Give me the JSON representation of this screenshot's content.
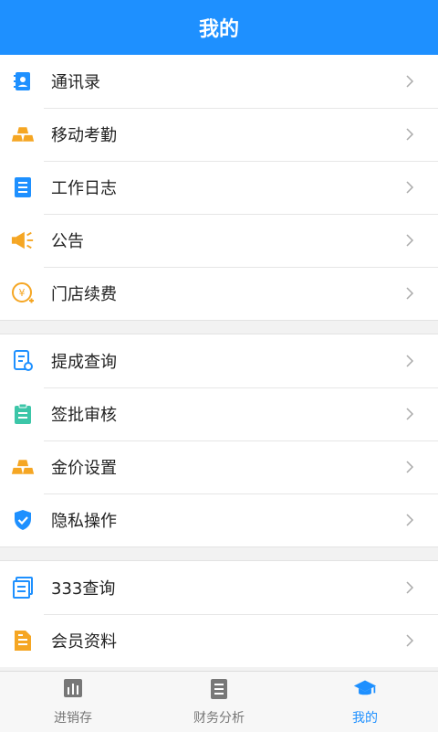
{
  "header": {
    "title": "我的"
  },
  "groups": [
    [
      {
        "label": "通讯录",
        "icon": "contacts-icon"
      },
      {
        "label": "移动考勤",
        "icon": "gold-bars-icon"
      },
      {
        "label": "工作日志",
        "icon": "notebook-icon"
      },
      {
        "label": "公告",
        "icon": "megaphone-icon"
      },
      {
        "label": "门店续费",
        "icon": "yen-coin-icon"
      }
    ],
    [
      {
        "label": "提成查询",
        "icon": "document-search-icon"
      },
      {
        "label": "签批审核",
        "icon": "clipboard-icon"
      },
      {
        "label": "金价设置",
        "icon": "gold-bars-icon"
      },
      {
        "label": "隐私操作",
        "icon": "shield-check-icon"
      }
    ],
    [
      {
        "label": "333查询",
        "icon": "report-icon"
      },
      {
        "label": "会员资料",
        "icon": "member-file-icon"
      }
    ]
  ],
  "tabs": [
    {
      "label": "进销存",
      "icon": "bar-chart-icon",
      "active": false
    },
    {
      "label": "财务分析",
      "icon": "ledger-icon",
      "active": false
    },
    {
      "label": "我的",
      "icon": "graduation-cap-icon",
      "active": true
    }
  ],
  "colors": {
    "primary": "#1e90ff",
    "gold": "#f5a623",
    "teal": "#3cc6a8"
  }
}
